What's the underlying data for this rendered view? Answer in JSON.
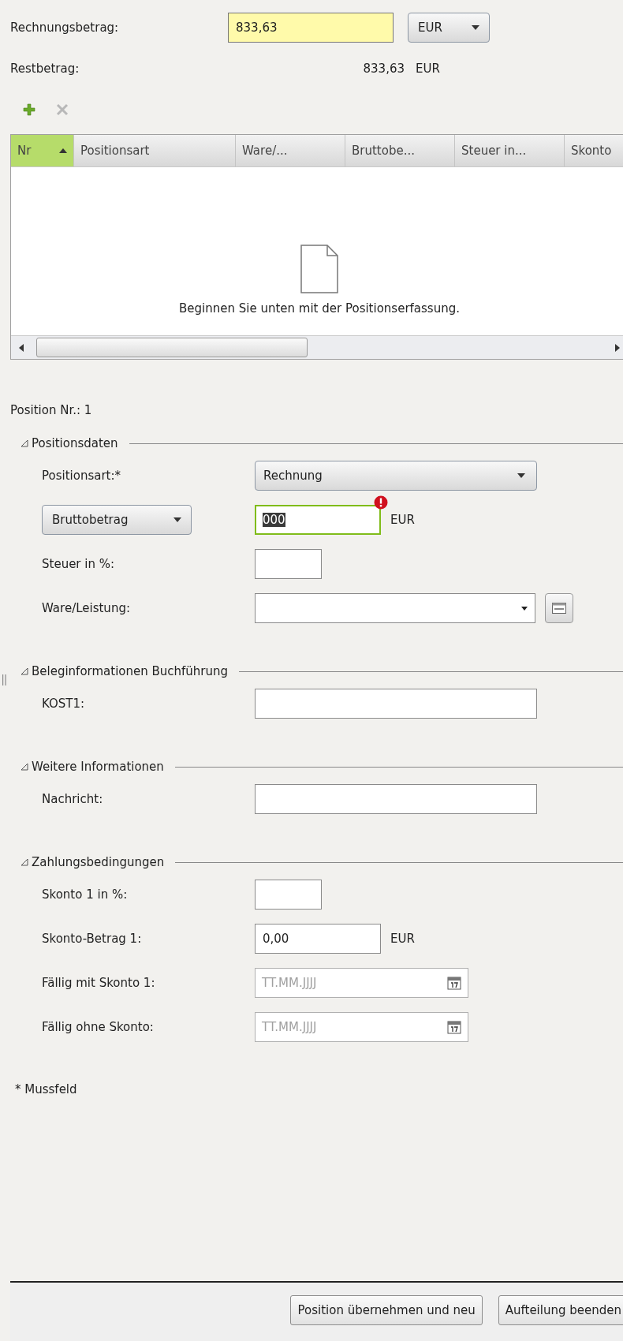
{
  "header": {
    "amount_label": "Rechnungsbetrag:",
    "amount_value": "833,63",
    "currency": "EUR",
    "rest_label": "Restbetrag:",
    "rest_value": "833,63",
    "rest_currency": "EUR"
  },
  "toolbar": [
    {
      "kind": "add",
      "disabled": false
    },
    {
      "kind": "delete",
      "disabled": true
    }
  ],
  "table": {
    "columns": [
      {
        "label": "Nr",
        "selected": true
      },
      {
        "label": "Positionsart",
        "selected": false
      },
      {
        "label": "Ware/...",
        "selected": false
      },
      {
        "label": "Bruttobe...",
        "selected": false
      },
      {
        "label": "Steuer in...",
        "selected": false
      },
      {
        "label": "Skonto",
        "selected": false
      }
    ],
    "empty_message": "Beginnen Sie unten mit der Positionserfassung."
  },
  "position_title": "Position Nr.: 1",
  "sections": [
    {
      "title": "Positionsdaten",
      "expanded": true,
      "rows": [
        {
          "kind": "select",
          "label": "Positionsart:*",
          "value": "Rechnung"
        },
        {
          "kind": "amount",
          "selector": "Bruttobetrag",
          "value": "000",
          "error": true,
          "text_selected": true,
          "unit": "EUR"
        },
        {
          "kind": "short",
          "label": "Steuer in %:"
        },
        {
          "kind": "combo",
          "label": "Ware/Leistung:"
        }
      ]
    },
    {
      "title": "Beleginformationen Buchführung",
      "expanded": true,
      "rows": [
        {
          "kind": "text",
          "label": "KOST1:"
        }
      ]
    },
    {
      "title": "Weitere Informationen",
      "expanded": true,
      "rows": [
        {
          "kind": "text",
          "label": "Nachricht:"
        }
      ]
    },
    {
      "title": "Zahlungsbedingungen",
      "expanded": true,
      "rows": [
        {
          "kind": "short",
          "label": "Skonto 1 in %:"
        },
        {
          "kind": "amount_plain",
          "label": "Skonto-Betrag 1:",
          "value": "0,00",
          "unit": "EUR"
        },
        {
          "kind": "date",
          "label": "Fällig mit Skonto 1:",
          "placeholder": "TT.MM.JJJJ",
          "disabled": true
        },
        {
          "kind": "date",
          "label": "Fällig ohne Skonto:",
          "placeholder": "TT.MM.JJJJ",
          "disabled": true
        }
      ]
    }
  ],
  "required_note": "* Mussfeld",
  "buttons": [
    "Position übernehmen und neu",
    "Aufteilung beenden"
  ]
}
